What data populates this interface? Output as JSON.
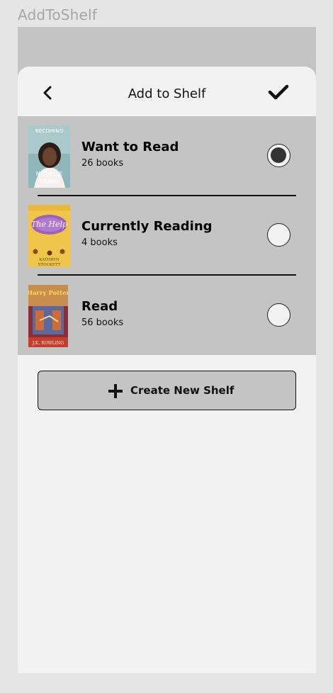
{
  "frame": {
    "label": "AddToShelf"
  },
  "header": {
    "title": "Add to Shelf",
    "back_icon": "chevron-left-icon",
    "done_icon": "checkmark-icon"
  },
  "shelves": [
    {
      "name": "Want to Read",
      "count": "26 books",
      "selected": true,
      "cover_text": [
        "BECOMING",
        "MICHELLE",
        "OBAMA"
      ]
    },
    {
      "name": "Currently Reading",
      "count": "4 books",
      "selected": false,
      "cover_text": [
        "The Help",
        "KATHRYN",
        "STOCKETT"
      ]
    },
    {
      "name": "Read",
      "count": "56 books",
      "selected": false,
      "cover_text": [
        "Harry Potter",
        "J.K. ROWLING"
      ]
    }
  ],
  "actions": {
    "create_label": "Create New Shelf",
    "create_icon": "plus-icon"
  },
  "colors": {
    "background": "#e5e5e5",
    "panel": "#c4c4c4",
    "sheet": "#f2f2f2",
    "text": "#111111"
  }
}
